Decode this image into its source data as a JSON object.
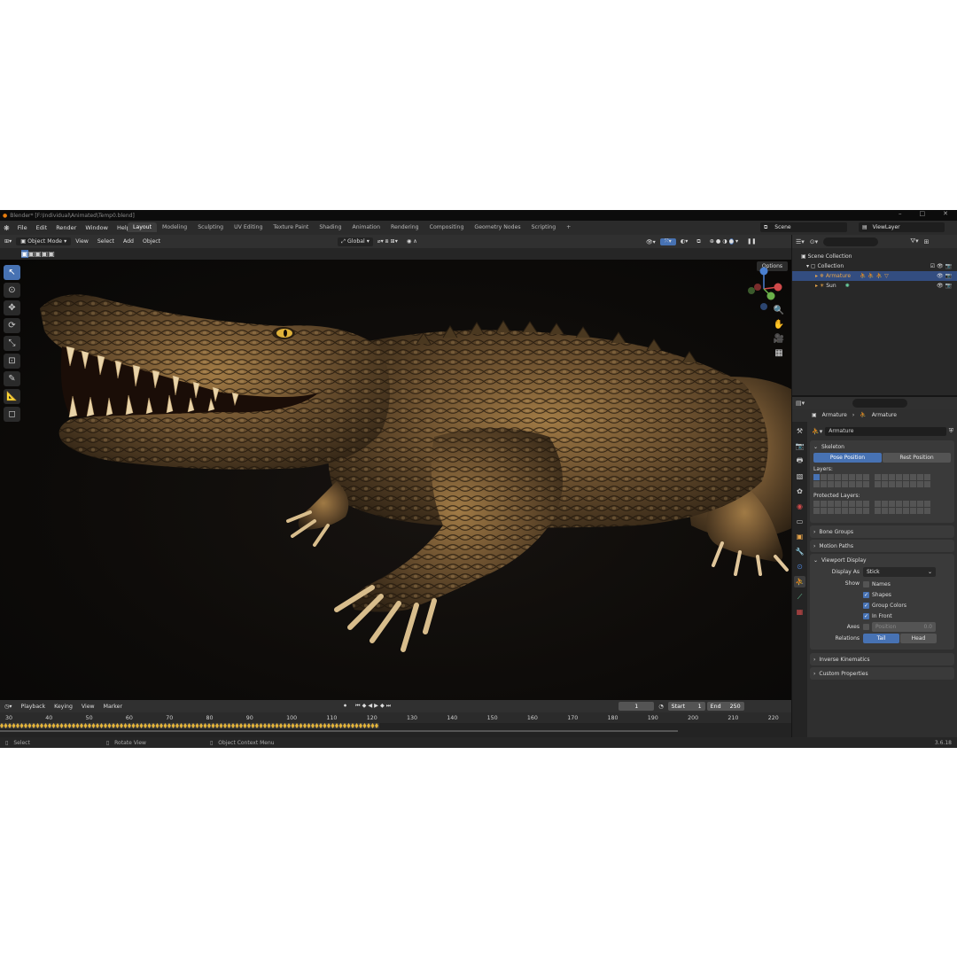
{
  "window": {
    "title": "Blender* [F:\\Individual\\Animated\\Temp0.blend]"
  },
  "menu": [
    "File",
    "Edit",
    "Render",
    "Window",
    "Help"
  ],
  "workspaces": [
    "Layout",
    "Modeling",
    "Sculpting",
    "UV Editing",
    "Texture Paint",
    "Shading",
    "Animation",
    "Rendering",
    "Compositing",
    "Geometry Nodes",
    "Scripting"
  ],
  "scene_name": "Scene",
  "view_layer": "ViewLayer",
  "viewport_header": {
    "mode": "Object Mode",
    "items": [
      "View",
      "Select",
      "Add",
      "Object"
    ],
    "transform": "Global"
  },
  "viewport": {
    "options_label": "Options"
  },
  "outliner": {
    "scene_collection": "Scene Collection",
    "collection": "Collection",
    "items": [
      {
        "name": "Armature",
        "color": "#e8a54a"
      },
      {
        "name": "Sun",
        "color": "#d0d0d0"
      }
    ]
  },
  "properties": {
    "breadcrumb": [
      "Armature",
      "Armature"
    ],
    "data_name": "Armature",
    "skeleton": {
      "title": "Skeleton",
      "pose_position": "Pose Position",
      "rest_position": "Rest Position",
      "layers_label": "Layers:",
      "protected_layers_label": "Protected Layers:"
    },
    "collapsed_panels": [
      "Bone Groups",
      "Motion Paths"
    ],
    "viewport_display": {
      "title": "Viewport Display",
      "display_as_label": "Display As",
      "display_as_value": "Stick",
      "show_label": "Show",
      "checks": [
        {
          "label": "Names",
          "checked": false
        },
        {
          "label": "Shapes",
          "checked": true
        },
        {
          "label": "Group Colors",
          "checked": true
        },
        {
          "label": "In Front",
          "checked": true
        }
      ],
      "axes_label": "Axes",
      "position_label": "Position",
      "position_value": "0.0",
      "relations_label": "Relations",
      "tail": "Tail",
      "head": "Head"
    },
    "bottom_panels": [
      "Inverse Kinematics",
      "Custom Properties"
    ]
  },
  "timeline": {
    "menus": [
      "Playback",
      "Keying",
      "View",
      "Marker"
    ],
    "current_frame": "1",
    "start_label": "Start",
    "start": "1",
    "end_label": "End",
    "end": "250",
    "ticks": [
      "30",
      "40",
      "50",
      "60",
      "70",
      "80",
      "90",
      "100",
      "110",
      "120",
      "130",
      "140",
      "150",
      "160",
      "170",
      "180",
      "190",
      "200",
      "210",
      "220"
    ]
  },
  "statusbar": {
    "select": "Select",
    "rotate": "Rotate View",
    "context": "Object Context Menu",
    "version": "3.6.18"
  },
  "colors": {
    "accent": "#4772b3",
    "active_object": "#e8a54a",
    "keyframe": "#e5b53a"
  }
}
